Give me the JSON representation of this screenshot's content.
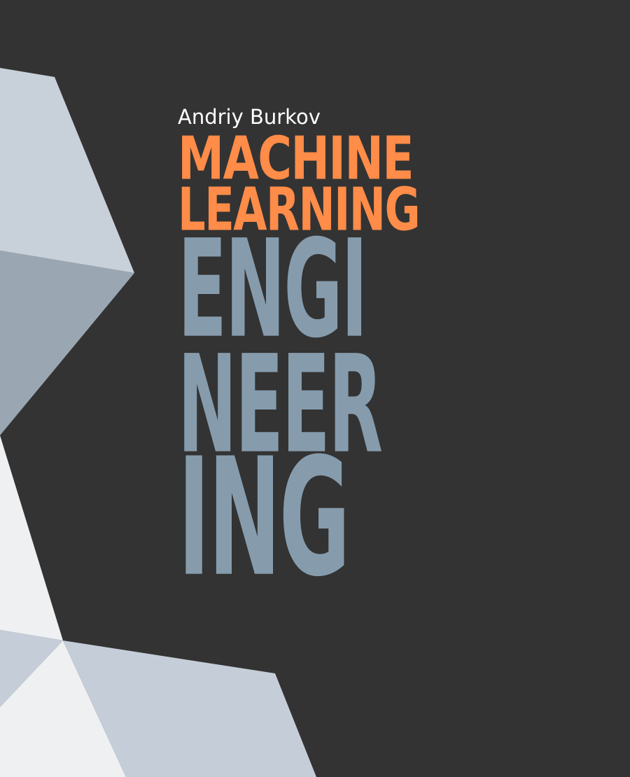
{
  "book": {
    "author": "Andriy Burkov",
    "title_line1": "MACHINE",
    "title_line2": "LEARNING",
    "title_line3": "ENGI",
    "title_line4": "NEER",
    "title_line5": "ING"
  },
  "colors": {
    "background": "#333333",
    "author": "#ffffff",
    "accent_orange": "#ff8c48",
    "slate_blue": "#869cad",
    "facet_light": "#c8d0d9",
    "facet_mid": "#9aa7b2",
    "facet_white": "#eef0f2",
    "facet_pale": "#c5ced8"
  }
}
